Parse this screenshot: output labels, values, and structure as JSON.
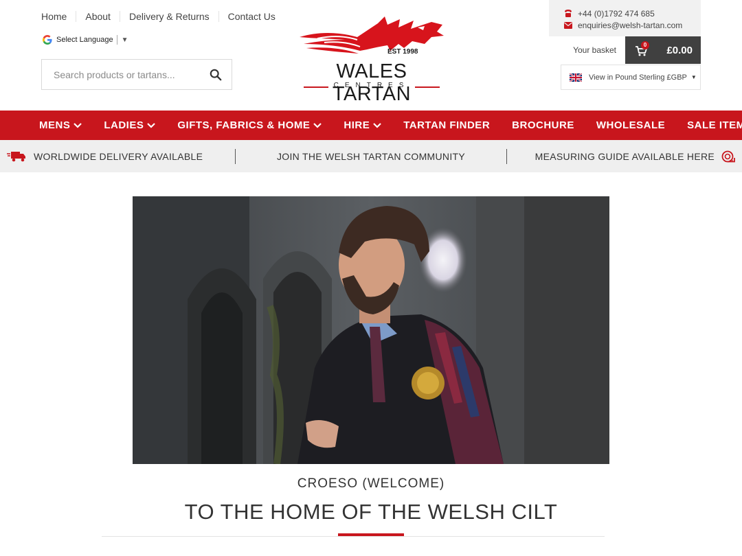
{
  "top_links": [
    "Home",
    "About",
    "Delivery & Returns",
    "Contact Us"
  ],
  "language": {
    "label": "Select Language",
    "arrow": "▼"
  },
  "search": {
    "placeholder": "Search products or tartans..."
  },
  "logo": {
    "est": "EST 1998",
    "name": "WALES TARTAN",
    "sub": "CENTRES"
  },
  "contact": {
    "phone": "+44 (0)1792 474 685",
    "email": "enquiries@welsh-tartan.com"
  },
  "basket": {
    "label": "Your basket",
    "count": "0",
    "total": "£0.00"
  },
  "currency": {
    "label": "View in Pound Sterling £GBP"
  },
  "nav": [
    {
      "label": "MENS",
      "dropdown": true
    },
    {
      "label": "LADIES",
      "dropdown": true
    },
    {
      "label": "GIFTS, FABRICS & HOME",
      "dropdown": true
    },
    {
      "label": "HIRE",
      "dropdown": true
    },
    {
      "label": "TARTAN FINDER",
      "dropdown": false
    },
    {
      "label": "BROCHURE",
      "dropdown": false
    },
    {
      "label": "WHOLESALE",
      "dropdown": false
    },
    {
      "label": "SALE ITEMS",
      "dropdown": false
    }
  ],
  "strip": {
    "delivery": "WORLDWIDE DELIVERY AVAILABLE",
    "community": "JOIN THE WELSH TARTAN COMMUNITY",
    "measuring": "MEASURING GUIDE AVAILABLE HERE"
  },
  "welcome": "CROESO (WELCOME)",
  "headline": "TO THE HOME OF THE WELSH CILT",
  "colors": {
    "brand_red": "#c8161d",
    "dark": "#404040",
    "strip_bg": "#efefef"
  }
}
